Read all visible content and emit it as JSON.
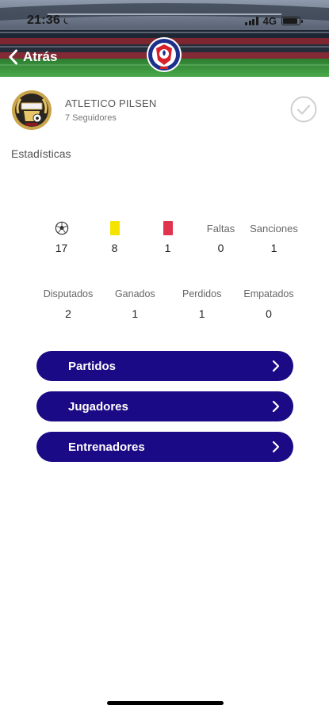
{
  "status_bar": {
    "time": "21:36",
    "network": "4G",
    "battery_level": 0.9
  },
  "nav": {
    "back_label": "Atrás"
  },
  "team": {
    "name": "ATLETICO PILSEN",
    "followers": "7 Seguidores",
    "following": false
  },
  "section": {
    "title": "Estadísticas"
  },
  "stats_primary": [
    {
      "icon": "soccer-ball-icon",
      "label": "",
      "value": "17"
    },
    {
      "icon": "yellow-card-icon",
      "label": "",
      "value": "8"
    },
    {
      "icon": "red-card-icon",
      "label": "",
      "value": "1"
    },
    {
      "icon": "",
      "label": "Faltas",
      "value": "0"
    },
    {
      "icon": "",
      "label": "Sanciones",
      "value": "1"
    }
  ],
  "stats_secondary": [
    {
      "label": "Disputados",
      "value": "2"
    },
    {
      "label": "Ganados",
      "value": "1"
    },
    {
      "label": "Perdidos",
      "value": "1"
    },
    {
      "label": "Empatados",
      "value": "0"
    }
  ],
  "buttons": {
    "partidos": "Partidos",
    "jugadores": "Jugadores",
    "entrenadores": "Entrenadores"
  },
  "colors": {
    "primary_button": "#1a0a85",
    "yellow_card": "#f4e400",
    "red_card": "#e0334d",
    "check_gray": "#d0d0d0"
  }
}
